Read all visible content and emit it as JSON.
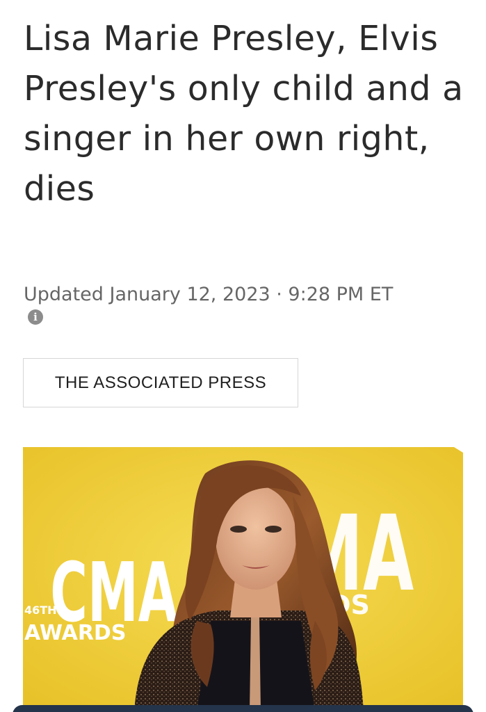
{
  "article": {
    "headline": "Lisa Marie Presley, Elvis Presley's only child and a singer in her own right, dies",
    "updated": "Updated January 12, 2023 · 9:28 PM ET",
    "source": "THE ASSOCIATED PRESS"
  },
  "photo": {
    "backdrop_logo_left": "CMA",
    "backdrop_edition": "46TH",
    "backdrop_awards": "AWARDS",
    "backdrop_logo_right": "MA",
    "backdrop_right_sub": "DS"
  },
  "icons": {
    "info": "info-icon"
  },
  "colors": {
    "backdrop_yellow": "#f1cf3d",
    "caption_bar": "#24344a"
  }
}
